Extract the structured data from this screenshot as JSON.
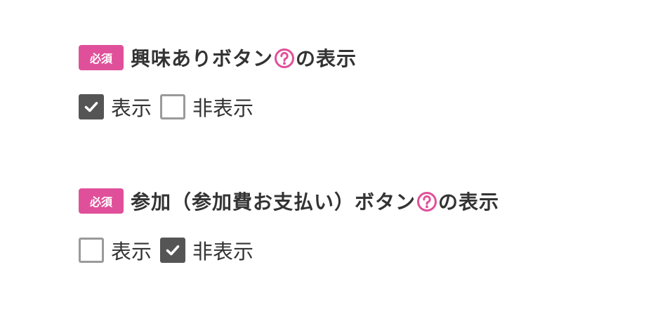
{
  "colors": {
    "accent": "#e0509a",
    "checked_box": "#555555",
    "unchecked_border": "#9a9a9a",
    "text": "#333333"
  },
  "fields": [
    {
      "required_label": "必須",
      "title_before_icon": "興味ありボタン",
      "title_after_icon": "の表示",
      "help_icon": "question-circle-icon",
      "options": [
        {
          "label": "表示",
          "checked": true
        },
        {
          "label": "非表示",
          "checked": false
        }
      ]
    },
    {
      "required_label": "必須",
      "title_before_icon": "参加（参加費お支払い）ボタン",
      "title_after_icon": "の表示",
      "help_icon": "question-circle-icon",
      "options": [
        {
          "label": "表示",
          "checked": false
        },
        {
          "label": "非表示",
          "checked": true
        }
      ]
    }
  ]
}
